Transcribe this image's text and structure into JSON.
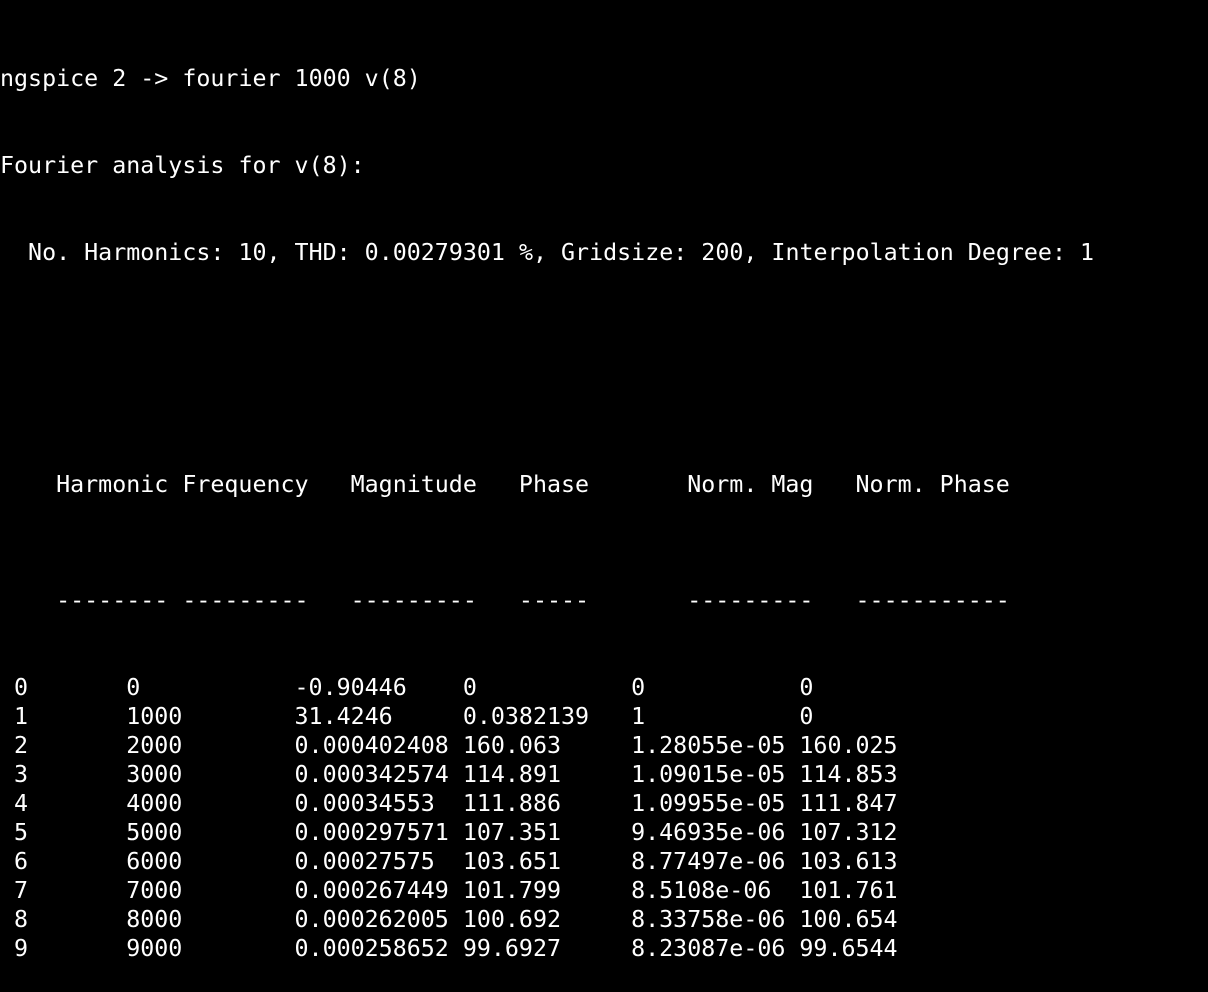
{
  "terminal": {
    "command_line": "ngspice 2 -> fourier 1000 v(8)",
    "analysis_title": "Fourier analysis for v(8):",
    "summary": "  No. Harmonics: 10, THD: 0.00279301 %, Gridsize: 200, Interpolation Degree: 1"
  },
  "table": {
    "headers": [
      "Harmonic",
      "Frequency",
      "Magnitude",
      "Phase",
      "Norm. Mag",
      "Norm. Phase"
    ],
    "separators": [
      "--------",
      "---------",
      "---------",
      "-----",
      "---------",
      "-----------"
    ],
    "rows": [
      [
        " 0",
        "0",
        "-0.90446",
        "0",
        "0",
        "0"
      ],
      [
        " 1",
        "1000",
        "31.4246",
        "0.0382139",
        "1",
        "0"
      ],
      [
        " 2",
        "2000",
        "0.000402408",
        "160.063",
        "1.28055e-05",
        "160.025"
      ],
      [
        " 3",
        "3000",
        "0.000342574",
        "114.891",
        "1.09015e-05",
        "114.853"
      ],
      [
        " 4",
        "4000",
        "0.00034553",
        "111.886",
        "1.09955e-05",
        "111.847"
      ],
      [
        " 5",
        "5000",
        "0.000297571",
        "107.351",
        "9.46935e-06",
        "107.312"
      ],
      [
        " 6",
        "6000",
        "0.00027575",
        "103.651",
        "8.77497e-06",
        "103.613"
      ],
      [
        " 7",
        "7000",
        "0.000267449",
        "101.799",
        "8.5108e-06",
        "101.761"
      ],
      [
        " 8",
        "8000",
        "0.000262005",
        "100.692",
        "8.33758e-06",
        "100.654"
      ],
      [
        " 9",
        "9000",
        "0.000258652",
        "99.6927",
        "8.23087e-06",
        "99.6544"
      ]
    ]
  }
}
